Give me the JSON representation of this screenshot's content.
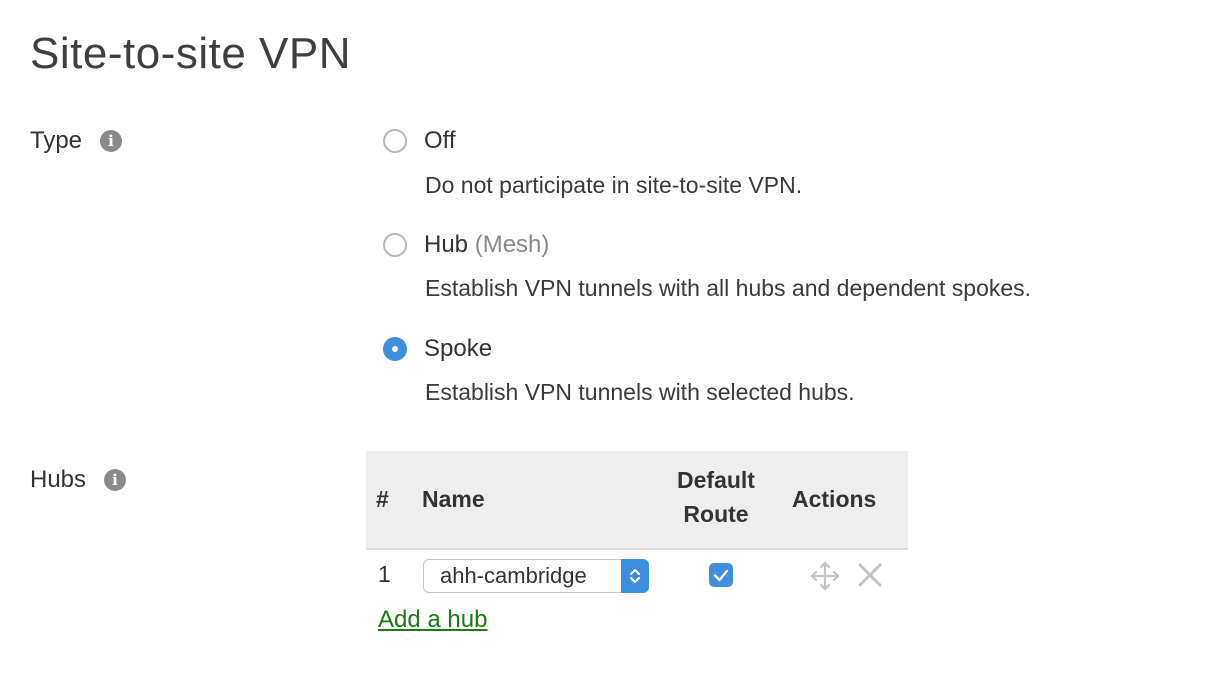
{
  "page": {
    "title": "Site-to-site VPN"
  },
  "type_field": {
    "label": "Type",
    "options": [
      {
        "label": "Off",
        "sublabel": "",
        "description": "Do not participate in site-to-site VPN.",
        "checked": false
      },
      {
        "label": "Hub",
        "sublabel": "(Mesh)",
        "description": "Establish VPN tunnels with all hubs and dependent spokes.",
        "checked": false
      },
      {
        "label": "Spoke",
        "sublabel": "",
        "description": "Establish VPN tunnels with selected hubs.",
        "checked": true
      }
    ]
  },
  "hubs_field": {
    "label": "Hubs",
    "columns": {
      "num": "#",
      "name": "Name",
      "default_route_1": "Default",
      "default_route_2": "Route",
      "actions": "Actions"
    },
    "rows": [
      {
        "num": "1",
        "name": "ahh-cambridge",
        "default_route": true
      }
    ],
    "add_link": "Add a hub"
  },
  "icons": {
    "info": "info-icon",
    "move": "move-icon",
    "delete": "close-icon",
    "select_arrows": "chevron-updown-icon",
    "check": "check-icon"
  },
  "colors": {
    "accent": "#3d8fe0",
    "link": "#1b7a16",
    "header_bg": "#eeeeee",
    "muted": "#8a8a8a"
  }
}
